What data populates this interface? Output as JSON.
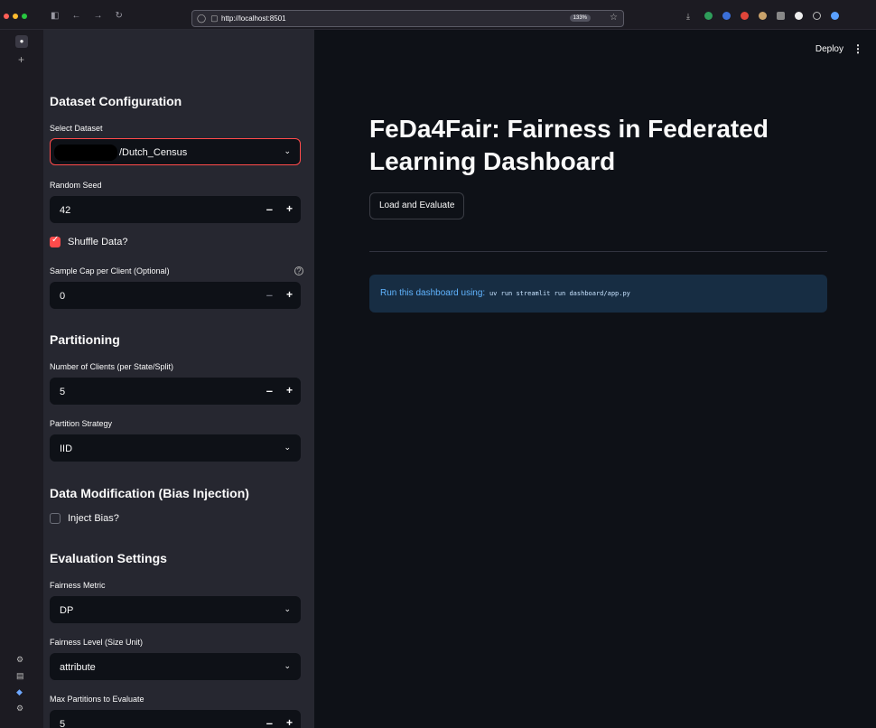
{
  "browser": {
    "url": "http://localhost:8501",
    "zoom": "133%"
  },
  "header": {
    "deploy_label": "Deploy"
  },
  "sidebar": {
    "dataset_config_title": "Dataset Configuration",
    "select_dataset_label": "Select Dataset",
    "select_dataset_value": "/Dutch_Census",
    "random_seed_label": "Random Seed",
    "random_seed_value": "42",
    "shuffle_label": "Shuffle Data?",
    "shuffle_checked": true,
    "sample_cap_label": "Sample Cap per Client (Optional)",
    "sample_cap_value": "0",
    "partitioning_title": "Partitioning",
    "num_clients_label": "Number of Clients (per State/Split)",
    "num_clients_value": "5",
    "partition_strategy_label": "Partition Strategy",
    "partition_strategy_value": "IID",
    "data_mod_title": "Data Modification (Bias Injection)",
    "inject_bias_label": "Inject Bias?",
    "inject_bias_checked": false,
    "eval_title": "Evaluation Settings",
    "fairness_metric_label": "Fairness Metric",
    "fairness_metric_value": "DP",
    "fairness_level_label": "Fairness Level (Size Unit)",
    "fairness_level_value": "attribute",
    "max_partitions_label": "Max Partitions to Evaluate",
    "max_partitions_value": "5"
  },
  "main": {
    "title": "FeDa4Fair: Fairness in Federated Learning Dashboard",
    "load_button": "Load and Evaluate",
    "info_text": "Run this dashboard using:",
    "info_code": "uv run streamlit run dashboard/app.py"
  },
  "colors": {
    "accent": "#ff4b4b",
    "sidebar_bg": "#262730",
    "main_bg": "#0e1117",
    "info_bg": "#172d43",
    "info_text": "#60b4ff"
  }
}
